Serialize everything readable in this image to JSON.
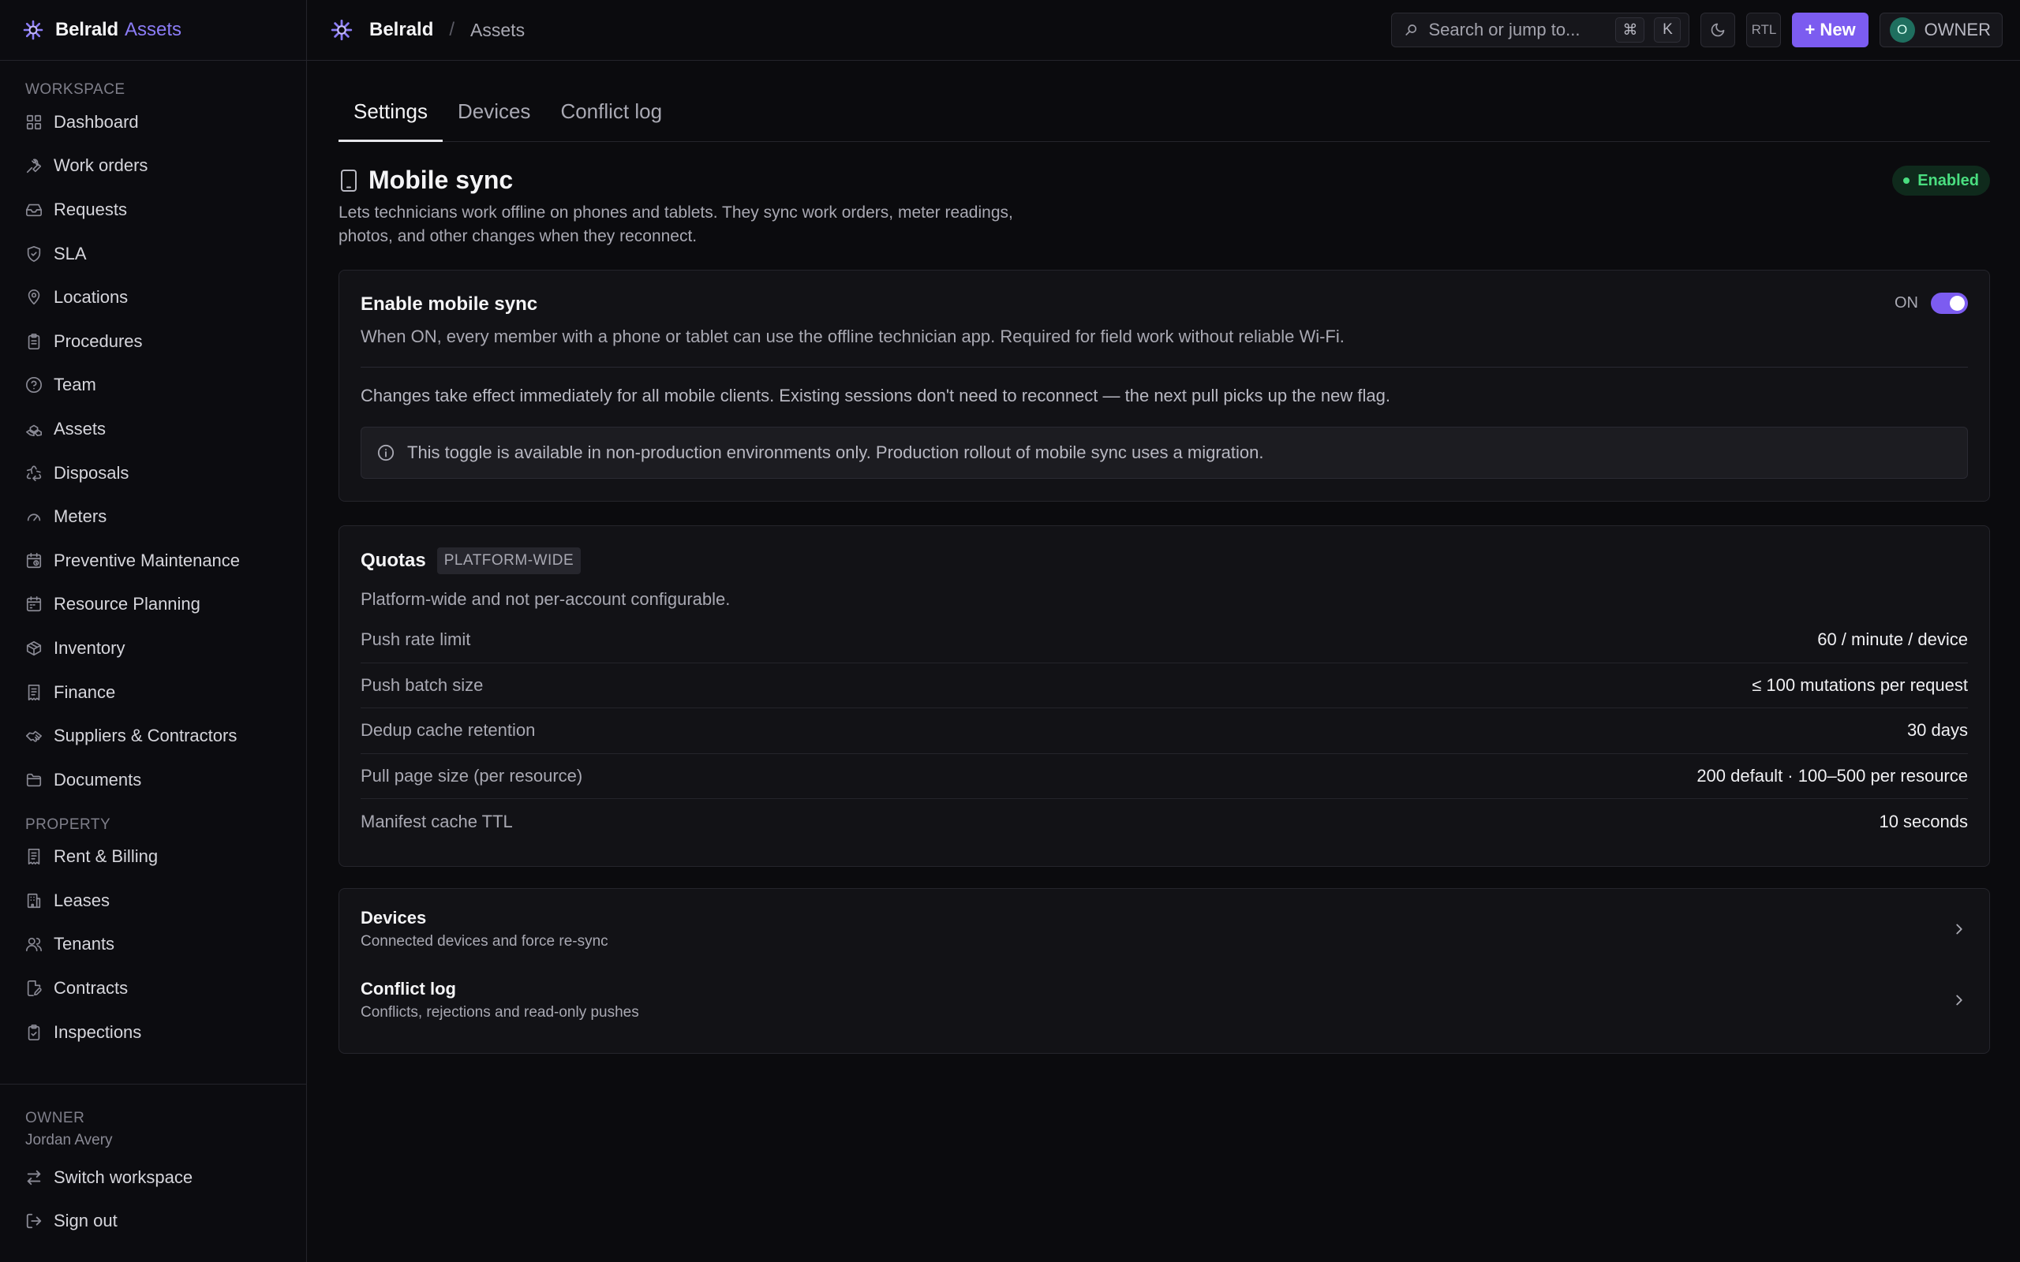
{
  "sidebar": {
    "brand_name": "Belrald",
    "brand_product": "Assets",
    "workspace_label": "WORKSPACE",
    "workspace_items": [
      {
        "label": "Dashboard",
        "icon": "grid-icon"
      },
      {
        "label": "Work orders",
        "icon": "wrench-icon"
      },
      {
        "label": "Requests",
        "icon": "inbox-icon"
      },
      {
        "label": "SLA",
        "icon": "shield-icon"
      },
      {
        "label": "Locations",
        "icon": "map-pin-icon"
      },
      {
        "label": "Procedures",
        "icon": "clipboard-icon"
      },
      {
        "label": "Team",
        "icon": "help-circle-icon"
      },
      {
        "label": "Assets",
        "icon": "boxes-icon"
      },
      {
        "label": "Disposals",
        "icon": "recycle-icon"
      },
      {
        "label": "Meters",
        "icon": "gauge-icon"
      },
      {
        "label": "Preventive Maintenance",
        "icon": "calendar-clock-icon"
      },
      {
        "label": "Resource Planning",
        "icon": "calendar-icon"
      },
      {
        "label": "Inventory",
        "icon": "package-icon"
      },
      {
        "label": "Finance",
        "icon": "receipt-icon"
      },
      {
        "label": "Suppliers & Contractors",
        "icon": "handshake-icon"
      },
      {
        "label": "Documents",
        "icon": "folder-icon"
      }
    ],
    "property_label": "PROPERTY",
    "property_items": [
      {
        "label": "Rent & Billing",
        "icon": "receipt-icon"
      },
      {
        "label": "Leases",
        "icon": "building-icon"
      },
      {
        "label": "Tenants",
        "icon": "users-icon"
      },
      {
        "label": "Contracts",
        "icon": "file-pen-icon"
      },
      {
        "label": "Inspections",
        "icon": "clipboard-check-icon"
      }
    ],
    "footer": {
      "role": "OWNER",
      "user_name": "Jordan Avery",
      "switch_label": "Switch workspace",
      "signout_label": "Sign out"
    }
  },
  "topbar": {
    "crumb_root": "Belrald",
    "crumb_sep": "/",
    "crumb_current": "Assets",
    "search_placeholder": "Search or jump to...",
    "kbd_cmd": "⌘",
    "kbd_k": "K",
    "rtl_label": "RTL",
    "new_label": "+ New",
    "avatar_letter": "O",
    "owner_label": "OWNER"
  },
  "tabs": [
    "Settings",
    "Devices",
    "Conflict log"
  ],
  "active_tab": "Settings",
  "page": {
    "title": "Mobile sync",
    "description": "Lets technicians work offline on phones and tablets. They sync work orders, meter readings, photos, and other changes when they reconnect.",
    "status_badge": "Enabled"
  },
  "sync_card": {
    "title": "Enable mobile sync",
    "toggle_label": "ON",
    "toggle_on": true,
    "description": "When ON, every member with a phone or tablet can use the offline technician app. Required for field work without reliable Wi-Fi.",
    "effect_note": "Changes take effect immediately for all mobile clients. Existing sessions don't need to reconnect — the next pull picks up the new flag.",
    "info_note": "This toggle is available in non-production environments only. Production rollout of mobile sync uses a migration."
  },
  "quotas": {
    "title": "Quotas",
    "badge": "PLATFORM-WIDE",
    "subtitle": "Platform-wide and not per-account configurable.",
    "rows": [
      {
        "key": "Push rate limit",
        "value": "60 / minute / device"
      },
      {
        "key": "Push batch size",
        "value": "≤ 100 mutations per request"
      },
      {
        "key": "Dedup cache retention",
        "value": "30 days"
      },
      {
        "key": "Pull page size (per resource)",
        "value": "200 default · 100–500 per resource"
      },
      {
        "key": "Manifest cache TTL",
        "value": "10 seconds"
      }
    ]
  },
  "links": [
    {
      "title": "Devices",
      "subtitle": "Connected devices and force re-sync"
    },
    {
      "title": "Conflict log",
      "subtitle": "Conflicts, rejections and read-only pushes"
    }
  ],
  "colors": {
    "accent": "#7c5cf0",
    "brand_accent": "#8b7cf6",
    "success": "#4ade80",
    "background": "#0b0b0e"
  }
}
